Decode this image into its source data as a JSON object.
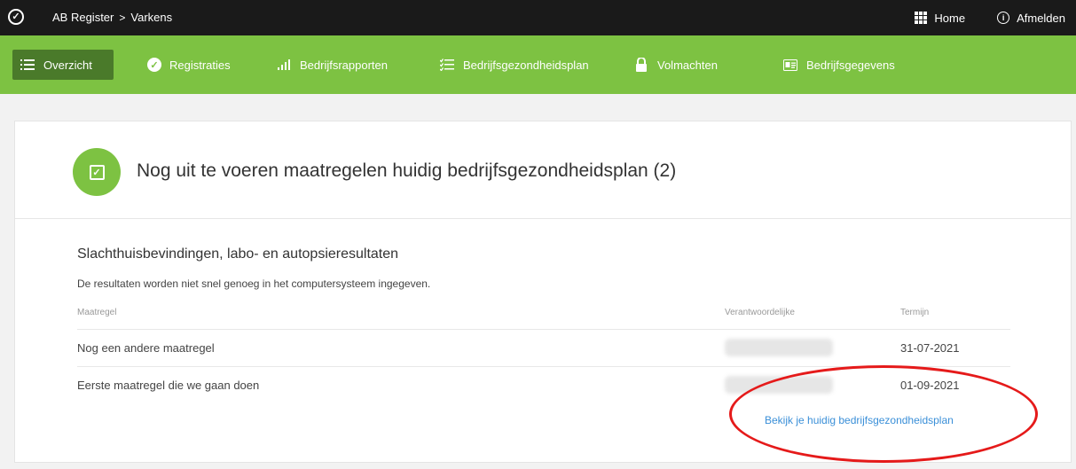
{
  "topbar": {
    "breadcrumb": [
      "AB Register",
      "Varkens"
    ],
    "breadcrumb_sep": ">",
    "home_label": "Home",
    "logout_label": "Afmelden"
  },
  "nav": {
    "items": [
      {
        "label": "Overzicht",
        "icon": "list-icon",
        "active": true
      },
      {
        "label": "Registraties",
        "icon": "check-circle-icon"
      },
      {
        "label": "Bedrijfsrapporten",
        "icon": "signal-bars-icon"
      },
      {
        "label": "Bedrijfsgezondheidsplan",
        "icon": "checklist-icon"
      },
      {
        "label": "Volmachten",
        "icon": "lock-icon"
      },
      {
        "label": "Bedrijfsgegevens",
        "icon": "id-card-icon"
      }
    ]
  },
  "card": {
    "title": "Nog uit te voeren maatregelen huidig bedrijfsgezondheidsplan (2)",
    "section_title": "Slachthuisbevindingen, labo- en autopsieresultaten",
    "section_desc": "De resultaten worden niet snel genoeg in het computersysteem ingegeven.",
    "columns": [
      "Maatregel",
      "Verantwoordelijke",
      "Termijn"
    ],
    "rows": [
      {
        "maatregel": "Nog een andere maatregel",
        "termijn": "31-07-2021"
      },
      {
        "maatregel": "Eerste maatregel die we gaan doen",
        "termijn": "01-09-2021"
      }
    ],
    "link_label": "Bekijk je huidig bedrijfsgezondheidsplan"
  },
  "colors": {
    "topbar": "#1a1a1a",
    "nav_green": "#7dc242",
    "nav_active": "#4a7a2a",
    "link": "#3a8fd8",
    "annotation_red": "#e51a1a"
  }
}
